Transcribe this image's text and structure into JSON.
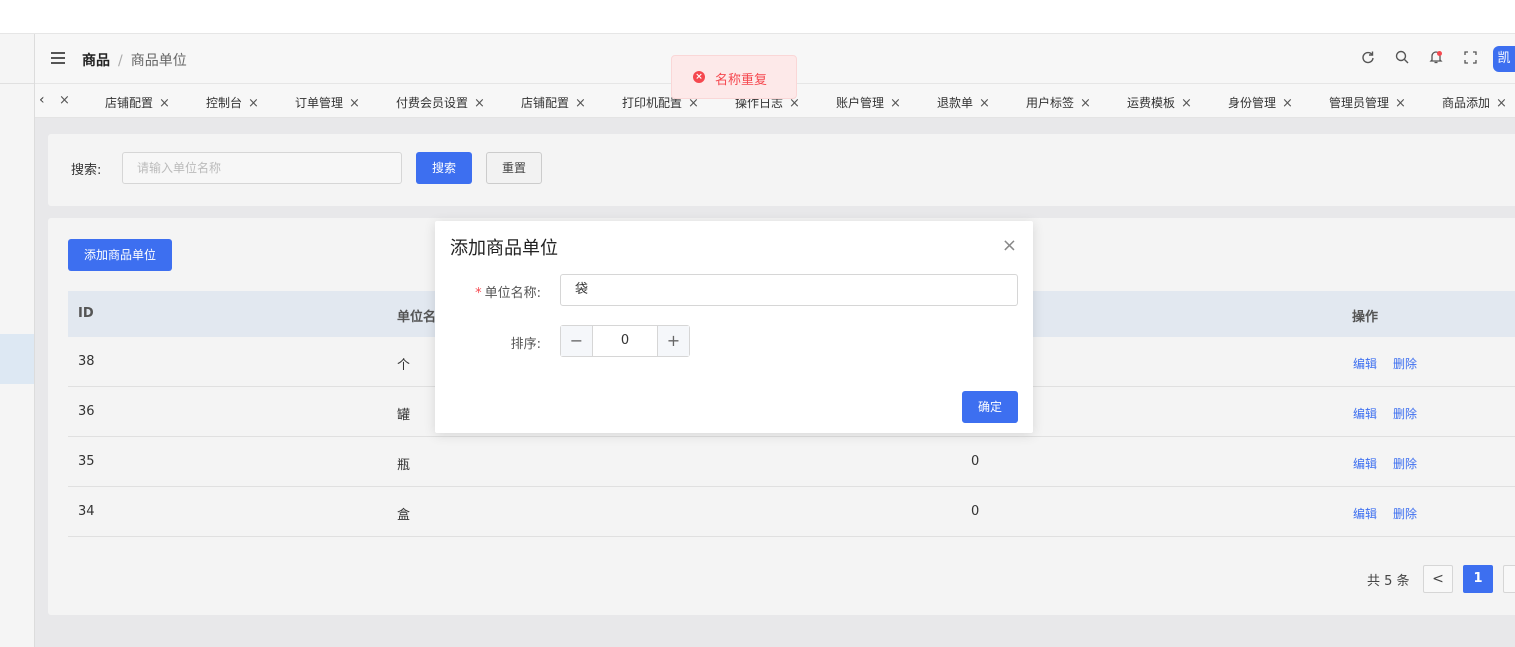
{
  "header": {
    "breadcrumb": [
      "商品",
      "商品单位"
    ],
    "separator": "/",
    "avatar_text": "凯",
    "icons": [
      "refresh-icon",
      "search-icon",
      "bell-icon",
      "fullscreen-icon"
    ]
  },
  "tabs": {
    "close_glyph": "×",
    "items": [
      "店铺配置",
      "控制台",
      "订单管理",
      "付费会员设置",
      "店铺配置",
      "打印机配置",
      "操作日志",
      "账户管理",
      "退款单",
      "用户标签",
      "运费模板",
      "身份管理",
      "管理员管理",
      "商品添加"
    ]
  },
  "search": {
    "label": "搜索:",
    "placeholder": "请输入单位名称",
    "search_button": "搜索",
    "reset_button": "重置"
  },
  "table": {
    "add_button": "添加商品单位",
    "columns": [
      "ID",
      "单位名称",
      "",
      "操作"
    ],
    "rows": [
      {
        "id": "38",
        "name": "个",
        "sort": "",
        "edit": "编辑",
        "delete": "删除"
      },
      {
        "id": "36",
        "name": "罐",
        "sort": "",
        "edit": "编辑",
        "delete": "删除"
      },
      {
        "id": "35",
        "name": "瓶",
        "sort": "0",
        "edit": "编辑",
        "delete": "删除"
      },
      {
        "id": "34",
        "name": "盒",
        "sort": "0",
        "edit": "编辑",
        "delete": "删除"
      }
    ]
  },
  "pagination": {
    "total": "共 5 条",
    "prev": "<",
    "current_page": "1"
  },
  "dialog": {
    "title": "添加商品单位",
    "close": "×",
    "required_mark": "*",
    "name_label": "单位名称:",
    "name_value": "袋",
    "sort_label": "排序:",
    "sort_minus": "−",
    "sort_value": "0",
    "sort_plus": "+",
    "confirm_button": "确定"
  },
  "toast": {
    "message": "名称重复",
    "type": "error",
    "color": "#f5484f"
  },
  "colors": {
    "primary": "#3d6ff0",
    "error": "#f5484f"
  }
}
